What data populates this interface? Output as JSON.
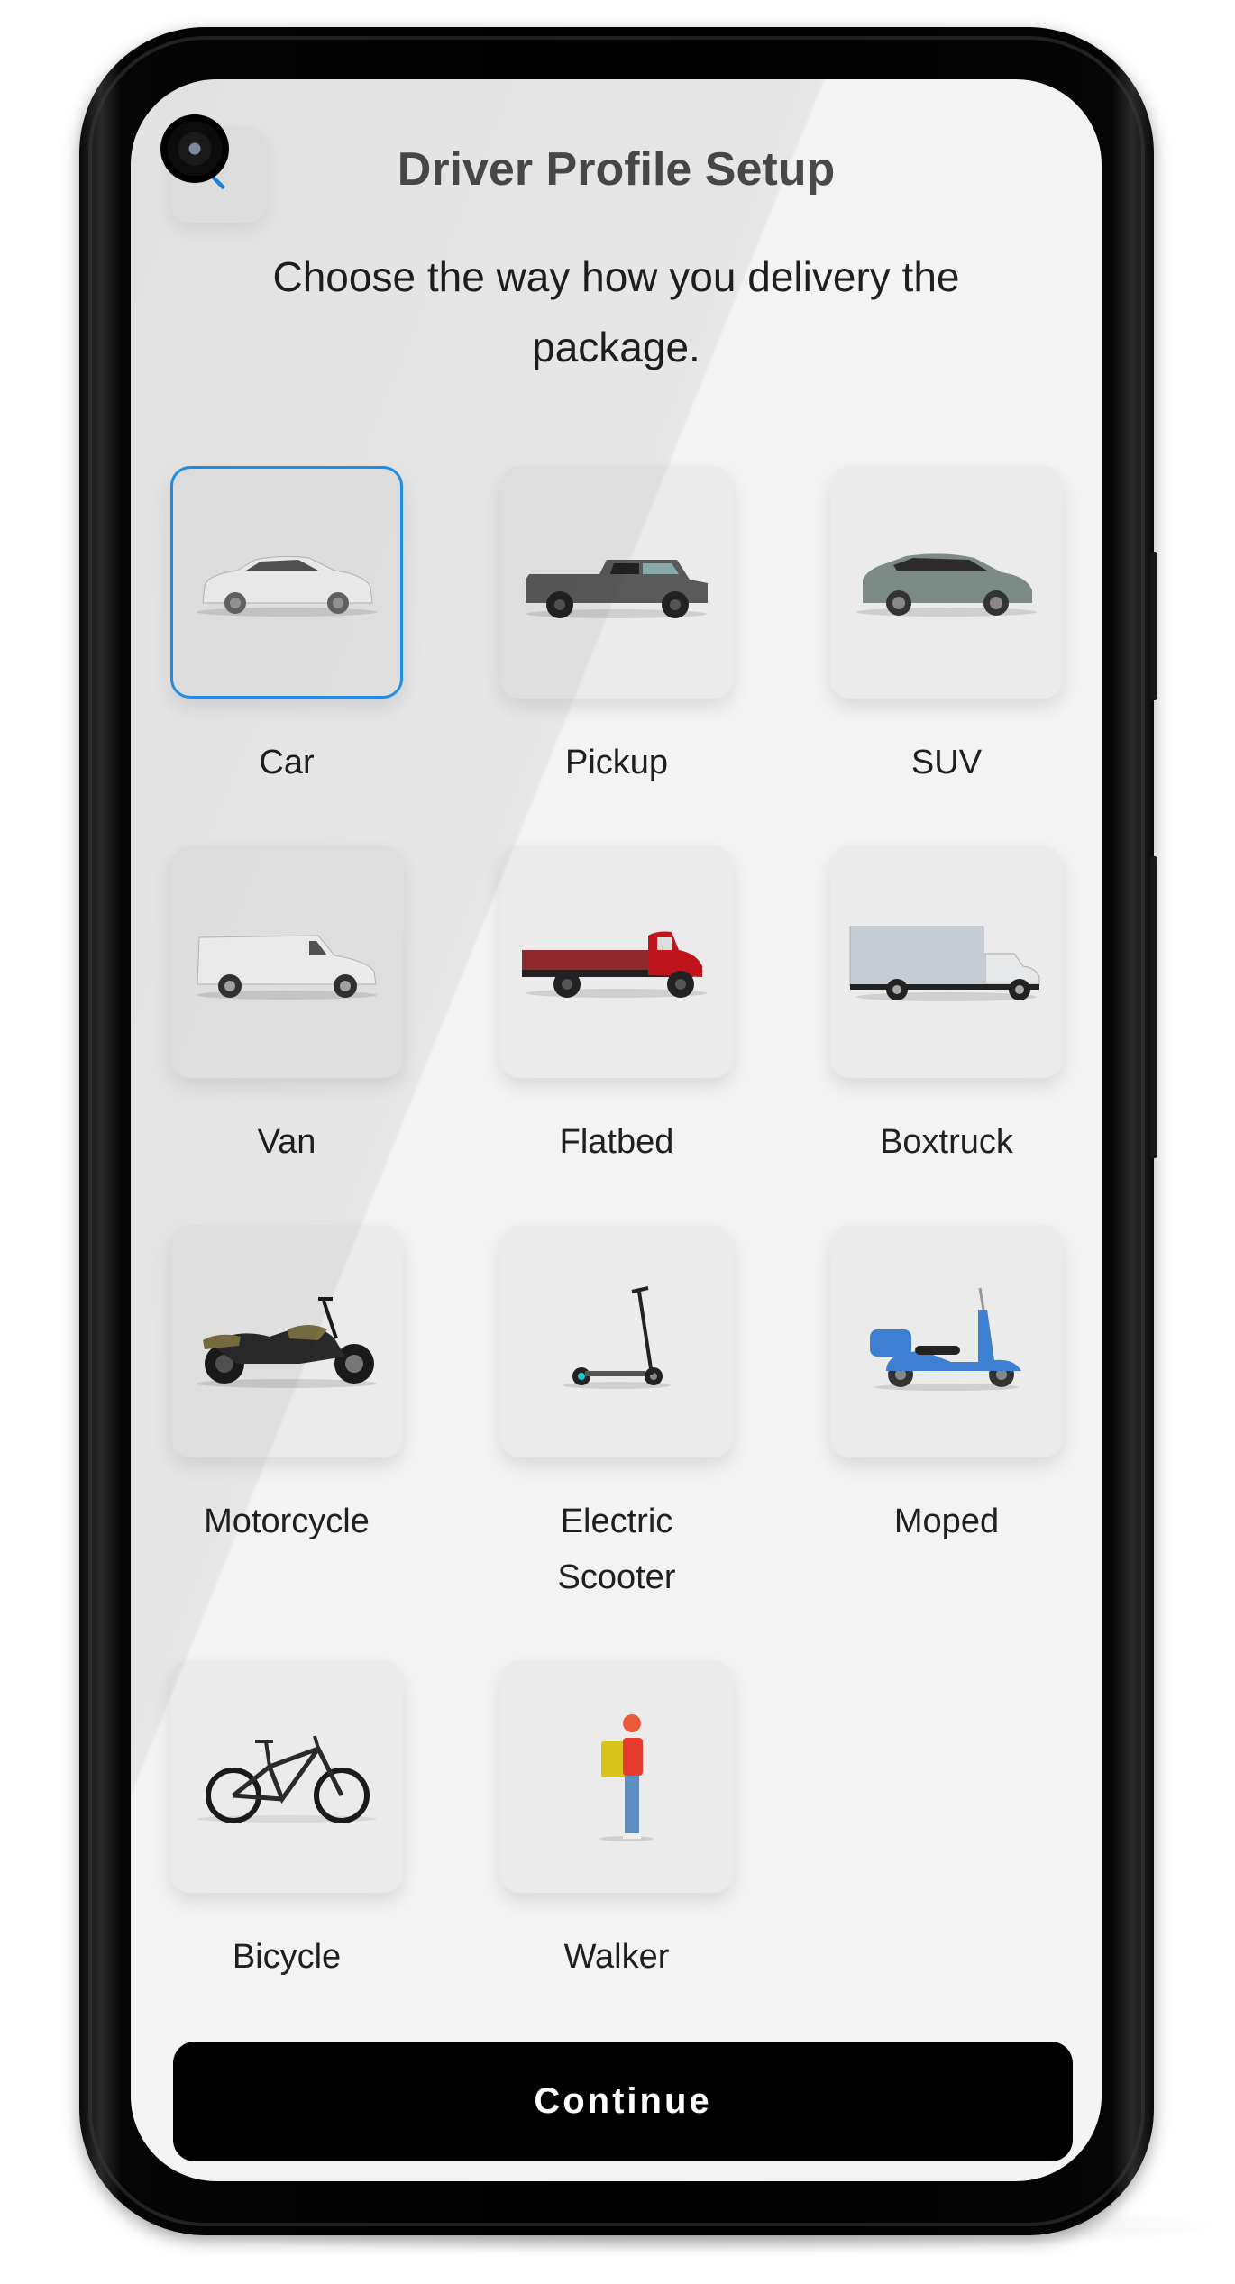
{
  "header": {
    "title": "Driver Profile Setup",
    "back_icon": "chevron-left-icon"
  },
  "prompt": "Choose the way how you delivery the package.",
  "accent_color": "#2196f3",
  "selected_option": "Car",
  "options": [
    {
      "label": "Car",
      "icon": "car-icon",
      "selected": true
    },
    {
      "label": "Pickup",
      "icon": "pickup-truck-icon",
      "selected": false
    },
    {
      "label": "SUV",
      "icon": "suv-icon",
      "selected": false
    },
    {
      "label": "Van",
      "icon": "van-icon",
      "selected": false
    },
    {
      "label": "Flatbed",
      "icon": "flatbed-truck-icon",
      "selected": false
    },
    {
      "label": "Boxtruck",
      "icon": "box-truck-icon",
      "selected": false
    },
    {
      "label": "Motorcycle",
      "icon": "motorcycle-icon",
      "selected": false
    },
    {
      "label": "Electric Scooter",
      "icon": "electric-scooter-icon",
      "selected": false
    },
    {
      "label": "Moped",
      "icon": "moped-icon",
      "selected": false
    },
    {
      "label": "Bicycle",
      "icon": "bicycle-icon",
      "selected": false
    },
    {
      "label": "Walker",
      "icon": "walker-icon",
      "selected": false
    }
  ],
  "footer": {
    "continue_label": "Continue"
  }
}
